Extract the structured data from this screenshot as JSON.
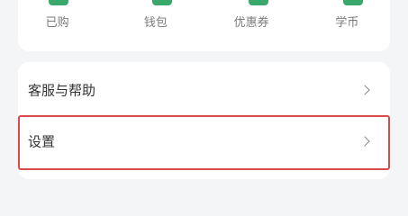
{
  "quick_actions": [
    {
      "label": "已购",
      "icon": "purchased-icon"
    },
    {
      "label": "钱包",
      "icon": "wallet-icon"
    },
    {
      "label": "优惠券",
      "icon": "coupon-icon"
    },
    {
      "label": "学币",
      "icon": "coin-icon"
    }
  ],
  "menu": {
    "items": [
      {
        "label": "客服与帮助",
        "icon": "chevron-right-icon"
      },
      {
        "label": "设置",
        "icon": "chevron-right-icon",
        "highlighted": true
      }
    ]
  },
  "colors": {
    "background": "#f4f5f7",
    "card": "#ffffff",
    "accent_green": "#3aa86b",
    "highlight_border": "#d94b4b",
    "label_gray": "#7a7a7a",
    "text": "#333333"
  }
}
